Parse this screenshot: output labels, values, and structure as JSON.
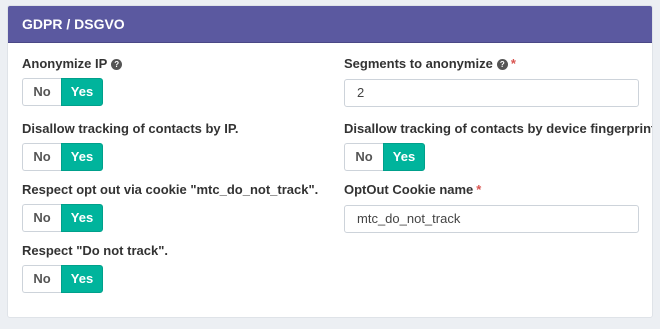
{
  "panel": {
    "title": "GDPR / DSGVO"
  },
  "left_fields": [
    {
      "label": "Anonymize IP",
      "help": "?",
      "no": "No",
      "yes": "Yes"
    },
    {
      "label": "Disallow tracking of contacts by IP.",
      "no": "No",
      "yes": "Yes"
    },
    {
      "label": "Respect opt out via cookie \"mtc_do_not_track\".",
      "no": "No",
      "yes": "Yes"
    },
    {
      "label": "Respect \"Do not track\".",
      "no": "No",
      "yes": "Yes"
    }
  ],
  "right_fields": {
    "segments": {
      "label": "Segments to anonymize",
      "help": "?",
      "required": "*",
      "value": "2"
    },
    "fingerprint": {
      "label": "Disallow tracking of contacts by device fingerprint.",
      "no": "No",
      "yes": "Yes"
    },
    "cookie_name": {
      "label": "OptOut Cookie name",
      "required": "*",
      "value": "mtc_do_not_track"
    }
  },
  "colors": {
    "header": "#5b59a0",
    "active_toggle": "#00b49c",
    "required": "#d9534f"
  }
}
